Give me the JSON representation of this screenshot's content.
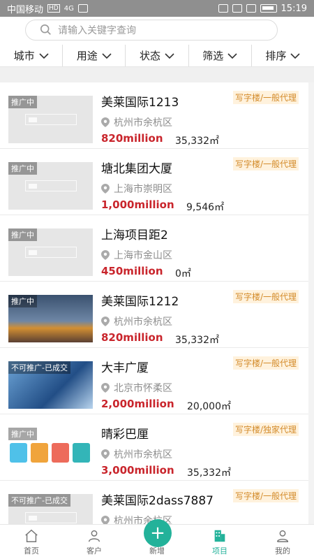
{
  "status_bar": {
    "carrier": "中国移动",
    "hd": "HD",
    "signal": "4G",
    "time": "15:19"
  },
  "search": {
    "placeholder": "请输入关键字查询"
  },
  "filters": [
    {
      "label": "城市"
    },
    {
      "label": "用途"
    },
    {
      "label": "状态"
    },
    {
      "label": "筛选"
    },
    {
      "label": "排序"
    }
  ],
  "listings": [
    {
      "badge": "推广中",
      "title": "美莱国际1213",
      "tag": "写字楼/一般代理",
      "location": "杭州市余杭区",
      "price": "820million",
      "area": "35,332㎡"
    },
    {
      "badge": "推广中",
      "title": "塘北集团大厦",
      "tag": "写字楼/一般代理",
      "location": "上海市崇明区",
      "price": "1,000million",
      "area": "9,546㎡"
    },
    {
      "badge": "推广中",
      "title": "上海项目距2",
      "tag": "",
      "location": "上海市金山区",
      "price": "450million",
      "area": "0㎡"
    },
    {
      "badge": "推广中",
      "title": "美莱国际1212",
      "tag": "写字楼/一般代理",
      "location": "杭州市余杭区",
      "price": "820million",
      "area": "35,332㎡"
    },
    {
      "badge": "不可推广-已成交",
      "title": "大丰广厦",
      "tag": "写字楼/一般代理",
      "location": "北京市怀柔区",
      "price": "2,000million",
      "area": "20,000㎡"
    },
    {
      "badge": "推广中",
      "title": "晴彩巴厘",
      "tag": "写字楼/独家代理",
      "location": "杭州市余杭区",
      "price": "3,000million",
      "area": "35,332㎡"
    },
    {
      "badge": "不可推广-已成交",
      "title": "美莱国际2dass7887",
      "tag": "写字楼/一般代理",
      "location": "杭州市余杭区",
      "price": "",
      "area": ""
    }
  ],
  "bottom_nav": [
    {
      "label": "首页"
    },
    {
      "label": "客户"
    },
    {
      "label": "新增"
    },
    {
      "label": "项目"
    },
    {
      "label": "我的"
    }
  ],
  "accent_color": "#23b29a",
  "price_color": "#c9252c",
  "tag_color": "#d38b2a"
}
